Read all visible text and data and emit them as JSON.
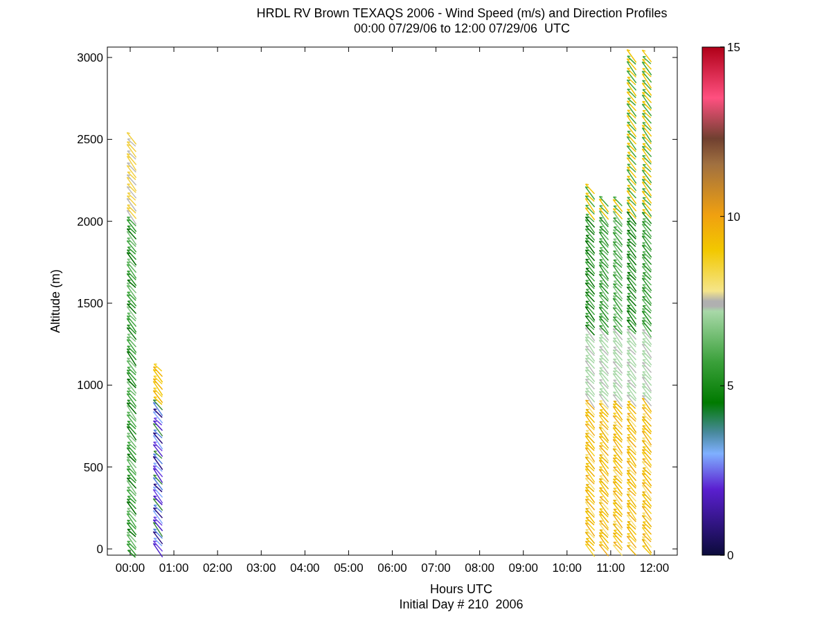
{
  "title": {
    "line1": "HRDL RV Brown TEXAQS 2006 - Wind Speed (m/s) and Direction Profiles",
    "line2": "00:00 07/29/06 to 12:00 07/29/06  UTC"
  },
  "y_axis": {
    "label": "Altitude (m)",
    "ticks": [
      "3000",
      "2500",
      "2000",
      "1500",
      "1000",
      "500",
      "0"
    ]
  },
  "x_axis": {
    "label": "Hours UTC",
    "ticks": [
      "00:00",
      "01:00",
      "02:00",
      "03:00",
      "04:00",
      "05:00",
      "06:00",
      "07:00",
      "08:00",
      "09:00",
      "10:00",
      "11:00",
      "12:00"
    ]
  },
  "footer": "Initial Day # 210  2006",
  "colorbar": {
    "ticks": [
      "15",
      "10",
      "5",
      "0"
    ]
  }
}
